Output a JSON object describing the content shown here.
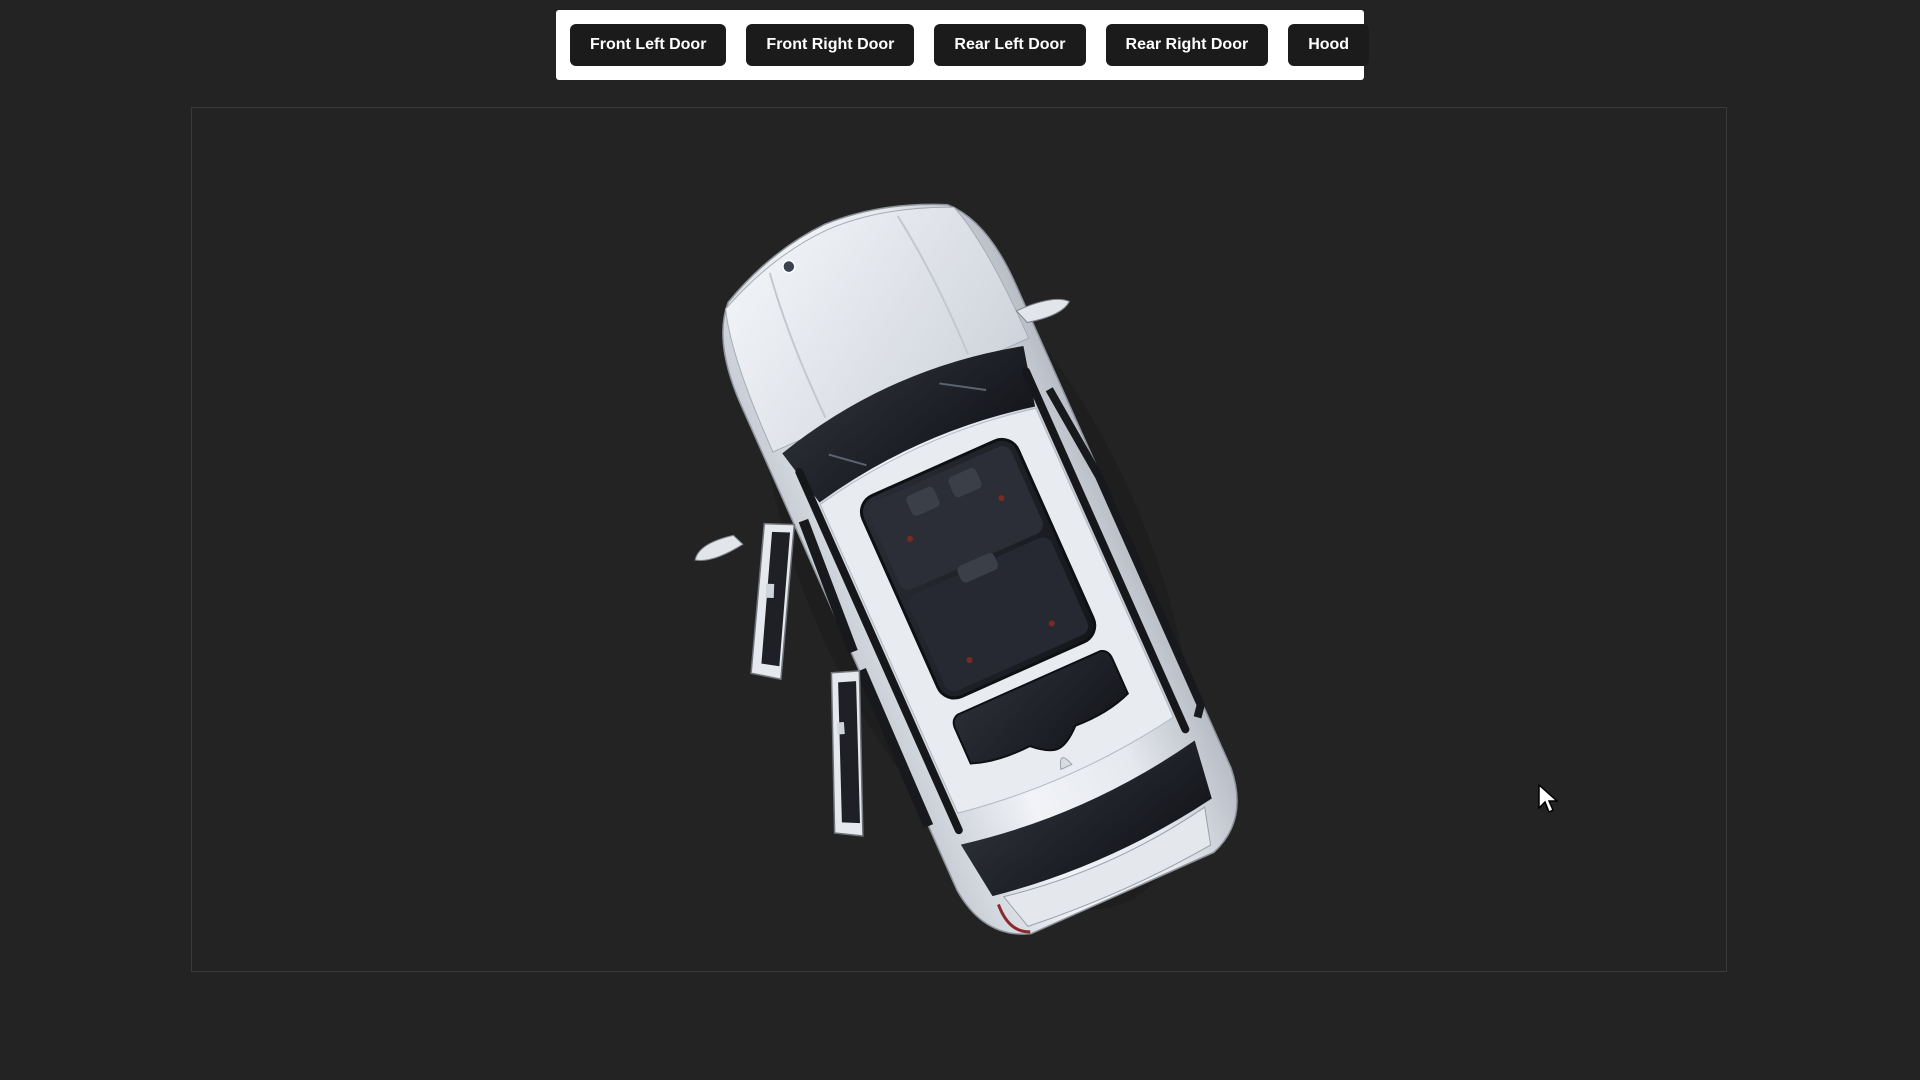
{
  "toolbar": {
    "buttons": [
      {
        "label": "Front Left Door"
      },
      {
        "label": "Front Right Door"
      },
      {
        "label": "Rear Left Door"
      },
      {
        "label": "Rear Right Door"
      },
      {
        "label": "Hood"
      }
    ]
  },
  "scene": {
    "model": "white-suv",
    "view": "top-down",
    "open_parts": [
      "Front Left Door",
      "Rear Left Door"
    ],
    "colors": {
      "background": "#232323",
      "car_body": "#e9ecf1",
      "glass": "#1c1e24",
      "button_bg": "#1b1b1b",
      "button_text": "#ffffff"
    }
  }
}
